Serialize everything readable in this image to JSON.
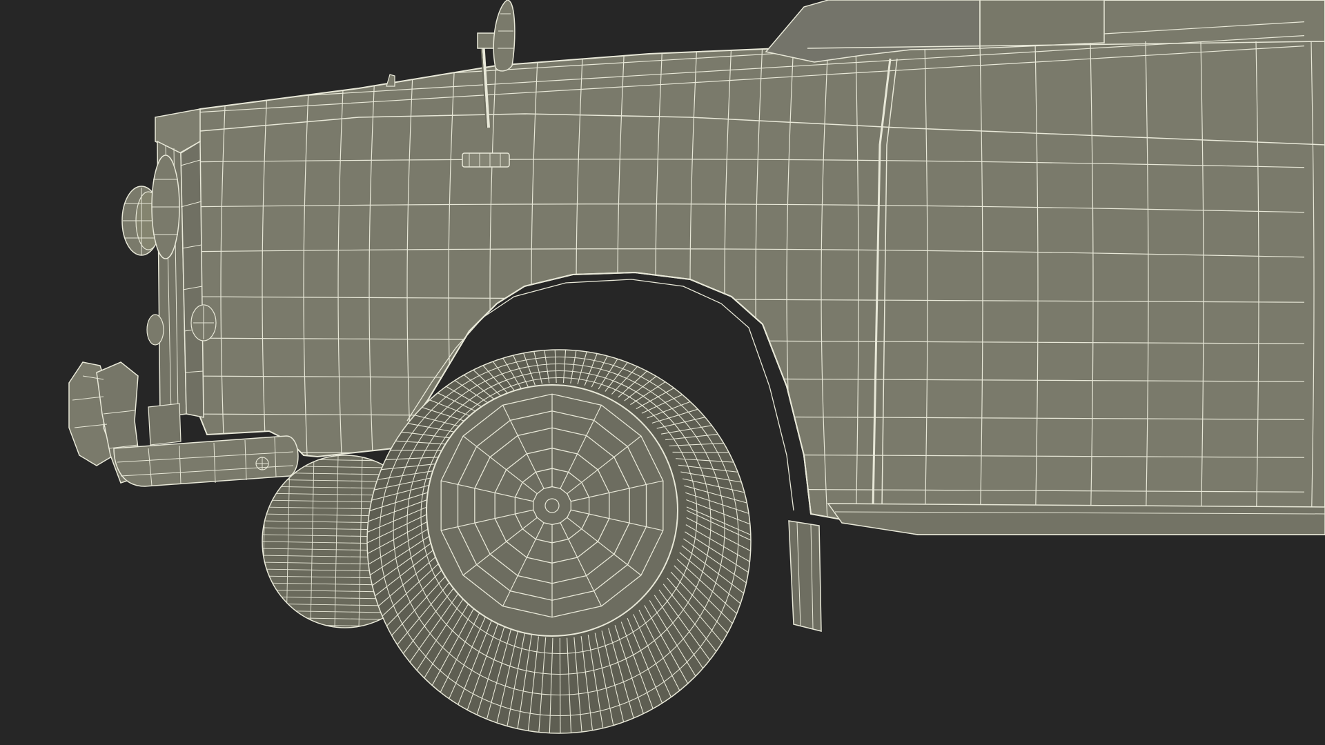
{
  "scene": {
    "background_color": "#262626",
    "surface_color": "#7a7a6b",
    "surface_shadow_color": "#6b6b5d",
    "surface_highlight_color": "#858575",
    "wire_color": "#e8e8d8",
    "tire_dark_color": "#5e5e52",
    "subject": "car-front-wireframe-model"
  }
}
